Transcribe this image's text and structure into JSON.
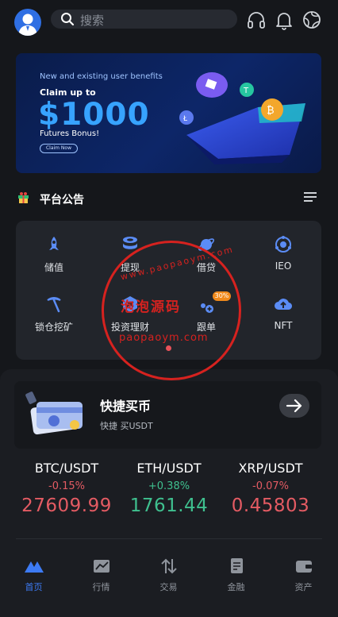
{
  "search": {
    "placeholder": "搜索"
  },
  "banner": {
    "headline": "New and existing user benefits",
    "claim": "Claim up to",
    "amount": "$1000",
    "bonus": "Futures Bonus!",
    "button": "Claim Now"
  },
  "notice": {
    "title": "平台公告"
  },
  "grid": {
    "items": [
      {
        "label": "储值",
        "icon": "rocket-icon"
      },
      {
        "label": "提现",
        "icon": "coin-stack-icon"
      },
      {
        "label": "借贷",
        "icon": "planet-icon"
      },
      {
        "label": "IEO",
        "icon": "orbit-icon"
      },
      {
        "label": "锁仓挖矿",
        "icon": "pickaxe-icon"
      },
      {
        "label": "投资理财",
        "icon": "hexagon-icon"
      },
      {
        "label": "跟单",
        "icon": "copy-trade-icon"
      },
      {
        "label": "NFT",
        "icon": "cloud-upload-icon"
      }
    ],
    "badge": "30%"
  },
  "quick_buy": {
    "title": "快捷买币",
    "subtitle": "快捷 买USDT"
  },
  "tickers": [
    {
      "pair": "BTC/USDT",
      "change": "-0.15%",
      "price": "27609.99",
      "direction": "down"
    },
    {
      "pair": "ETH/USDT",
      "change": "+0.38%",
      "price": "1761.44",
      "direction": "up"
    },
    {
      "pair": "XRP/USDT",
      "change": "-0.07%",
      "price": "0.45803",
      "direction": "down"
    }
  ],
  "nav": [
    {
      "label": "首页",
      "icon": "home-icon",
      "active": true
    },
    {
      "label": "行情",
      "icon": "chart-icon",
      "active": false
    },
    {
      "label": "交易",
      "icon": "trade-arrows-icon",
      "active": false
    },
    {
      "label": "金融",
      "icon": "finance-icon",
      "active": false
    },
    {
      "label": "资产",
      "icon": "wallet-icon",
      "active": false
    }
  ],
  "watermark": {
    "site": "泡泡源码",
    "url": "paopaoym.com",
    "arc": "www.paopaoym.com"
  },
  "colors": {
    "accent": "#3d7bf5",
    "negative": "#e45b63",
    "positive": "#3fc08f",
    "background": "#15171b"
  }
}
